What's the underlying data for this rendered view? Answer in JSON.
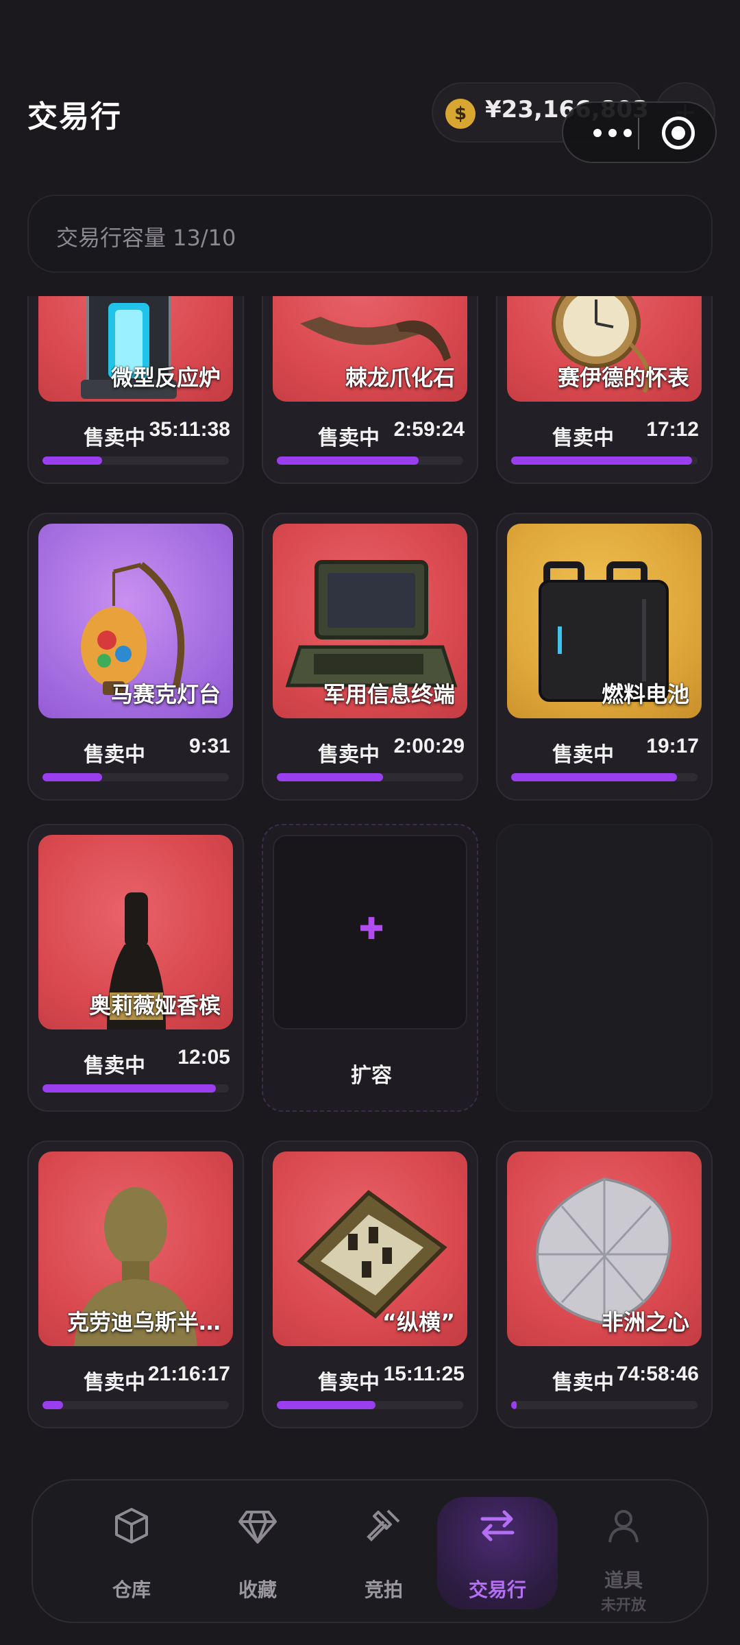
{
  "header": {
    "title": "交易行",
    "balance": "¥23,166,803",
    "coin_symbol": "$",
    "add_symbol": "+"
  },
  "capacity": {
    "text": "交易行容量 13/10"
  },
  "listings": [
    {
      "name": "微型反应炉",
      "status": "售卖中",
      "time": "35:11:38",
      "progress": 0.32,
      "color": "red",
      "icon": "reactor-icon"
    },
    {
      "name": "棘龙爪化石",
      "status": "售卖中",
      "time": "2:59:24",
      "progress": 0.76,
      "color": "red",
      "icon": "claw-fossil-icon"
    },
    {
      "name": "赛伊德的怀表",
      "status": "售卖中",
      "time": "17:12",
      "progress": 0.97,
      "color": "red",
      "icon": "pocket-watch-icon"
    },
    {
      "name": "马赛克灯台",
      "status": "售卖中",
      "time": "9:31",
      "progress": 0.32,
      "color": "purple",
      "icon": "mosaic-lamp-icon"
    },
    {
      "name": "军用信息终端",
      "status": "售卖中",
      "time": "2:00:29",
      "progress": 0.57,
      "color": "red",
      "icon": "military-terminal-icon"
    },
    {
      "name": "燃料电池",
      "status": "售卖中",
      "time": "19:17",
      "progress": 0.89,
      "color": "gold",
      "icon": "fuel-cell-icon"
    },
    {
      "name": "奥莉薇娅香槟",
      "status": "售卖中",
      "time": "12:05",
      "progress": 0.93,
      "color": "red",
      "icon": "champagne-icon"
    },
    {
      "name": "克劳迪乌斯半…",
      "status": "售卖中",
      "time": "21:16:17",
      "progress": 0.11,
      "color": "red",
      "icon": "bust-icon"
    },
    {
      "name": "“纵横”",
      "status": "售卖中",
      "time": "15:11:25",
      "progress": 0.53,
      "color": "red",
      "icon": "chessboard-icon"
    },
    {
      "name": "非洲之心",
      "status": "售卖中",
      "time": "74:58:46",
      "progress": 0.03,
      "color": "red",
      "icon": "diamond-icon"
    }
  ],
  "expand": {
    "plus": "✚",
    "label": "扩容"
  },
  "nav": {
    "items": [
      {
        "label": "仓库",
        "icon": "box-icon"
      },
      {
        "label": "收藏",
        "icon": "gem-icon"
      },
      {
        "label": "竞拍",
        "icon": "gavel-icon"
      },
      {
        "label": "交易行",
        "icon": "swap-arrows-icon",
        "active": true
      },
      {
        "label": "道具",
        "sub": "未开放",
        "icon": "person-icon",
        "disabled": true
      }
    ]
  },
  "colors": {
    "accent": "#9a3ff0",
    "background": "#1b191e",
    "card_red": "#d9494f",
    "card_purple": "#a56ee0",
    "card_gold": "#dfa73a"
  }
}
